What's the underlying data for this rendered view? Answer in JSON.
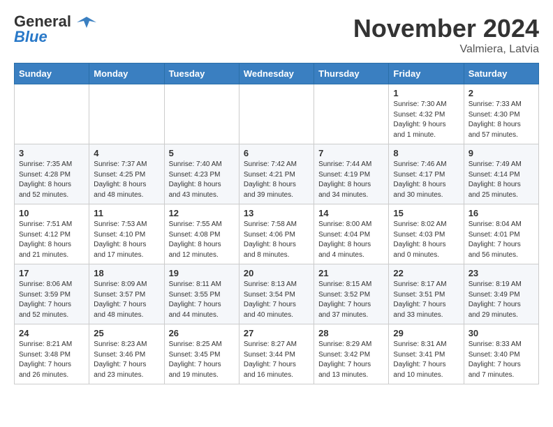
{
  "logo": {
    "general": "General",
    "blue": "Blue"
  },
  "title": "November 2024",
  "subtitle": "Valmiera, Latvia",
  "days_of_week": [
    "Sunday",
    "Monday",
    "Tuesday",
    "Wednesday",
    "Thursday",
    "Friday",
    "Saturday"
  ],
  "weeks": [
    [
      {
        "day": "",
        "info": ""
      },
      {
        "day": "",
        "info": ""
      },
      {
        "day": "",
        "info": ""
      },
      {
        "day": "",
        "info": ""
      },
      {
        "day": "",
        "info": ""
      },
      {
        "day": "1",
        "info": "Sunrise: 7:30 AM\nSunset: 4:32 PM\nDaylight: 9 hours\nand 1 minute."
      },
      {
        "day": "2",
        "info": "Sunrise: 7:33 AM\nSunset: 4:30 PM\nDaylight: 8 hours\nand 57 minutes."
      }
    ],
    [
      {
        "day": "3",
        "info": "Sunrise: 7:35 AM\nSunset: 4:28 PM\nDaylight: 8 hours\nand 52 minutes."
      },
      {
        "day": "4",
        "info": "Sunrise: 7:37 AM\nSunset: 4:25 PM\nDaylight: 8 hours\nand 48 minutes."
      },
      {
        "day": "5",
        "info": "Sunrise: 7:40 AM\nSunset: 4:23 PM\nDaylight: 8 hours\nand 43 minutes."
      },
      {
        "day": "6",
        "info": "Sunrise: 7:42 AM\nSunset: 4:21 PM\nDaylight: 8 hours\nand 39 minutes."
      },
      {
        "day": "7",
        "info": "Sunrise: 7:44 AM\nSunset: 4:19 PM\nDaylight: 8 hours\nand 34 minutes."
      },
      {
        "day": "8",
        "info": "Sunrise: 7:46 AM\nSunset: 4:17 PM\nDaylight: 8 hours\nand 30 minutes."
      },
      {
        "day": "9",
        "info": "Sunrise: 7:49 AM\nSunset: 4:14 PM\nDaylight: 8 hours\nand 25 minutes."
      }
    ],
    [
      {
        "day": "10",
        "info": "Sunrise: 7:51 AM\nSunset: 4:12 PM\nDaylight: 8 hours\nand 21 minutes."
      },
      {
        "day": "11",
        "info": "Sunrise: 7:53 AM\nSunset: 4:10 PM\nDaylight: 8 hours\nand 17 minutes."
      },
      {
        "day": "12",
        "info": "Sunrise: 7:55 AM\nSunset: 4:08 PM\nDaylight: 8 hours\nand 12 minutes."
      },
      {
        "day": "13",
        "info": "Sunrise: 7:58 AM\nSunset: 4:06 PM\nDaylight: 8 hours\nand 8 minutes."
      },
      {
        "day": "14",
        "info": "Sunrise: 8:00 AM\nSunset: 4:04 PM\nDaylight: 8 hours\nand 4 minutes."
      },
      {
        "day": "15",
        "info": "Sunrise: 8:02 AM\nSunset: 4:03 PM\nDaylight: 8 hours\nand 0 minutes."
      },
      {
        "day": "16",
        "info": "Sunrise: 8:04 AM\nSunset: 4:01 PM\nDaylight: 7 hours\nand 56 minutes."
      }
    ],
    [
      {
        "day": "17",
        "info": "Sunrise: 8:06 AM\nSunset: 3:59 PM\nDaylight: 7 hours\nand 52 minutes."
      },
      {
        "day": "18",
        "info": "Sunrise: 8:09 AM\nSunset: 3:57 PM\nDaylight: 7 hours\nand 48 minutes."
      },
      {
        "day": "19",
        "info": "Sunrise: 8:11 AM\nSunset: 3:55 PM\nDaylight: 7 hours\nand 44 minutes."
      },
      {
        "day": "20",
        "info": "Sunrise: 8:13 AM\nSunset: 3:54 PM\nDaylight: 7 hours\nand 40 minutes."
      },
      {
        "day": "21",
        "info": "Sunrise: 8:15 AM\nSunset: 3:52 PM\nDaylight: 7 hours\nand 37 minutes."
      },
      {
        "day": "22",
        "info": "Sunrise: 8:17 AM\nSunset: 3:51 PM\nDaylight: 7 hours\nand 33 minutes."
      },
      {
        "day": "23",
        "info": "Sunrise: 8:19 AM\nSunset: 3:49 PM\nDaylight: 7 hours\nand 29 minutes."
      }
    ],
    [
      {
        "day": "24",
        "info": "Sunrise: 8:21 AM\nSunset: 3:48 PM\nDaylight: 7 hours\nand 26 minutes."
      },
      {
        "day": "25",
        "info": "Sunrise: 8:23 AM\nSunset: 3:46 PM\nDaylight: 7 hours\nand 23 minutes."
      },
      {
        "day": "26",
        "info": "Sunrise: 8:25 AM\nSunset: 3:45 PM\nDaylight: 7 hours\nand 19 minutes."
      },
      {
        "day": "27",
        "info": "Sunrise: 8:27 AM\nSunset: 3:44 PM\nDaylight: 7 hours\nand 16 minutes."
      },
      {
        "day": "28",
        "info": "Sunrise: 8:29 AM\nSunset: 3:42 PM\nDaylight: 7 hours\nand 13 minutes."
      },
      {
        "day": "29",
        "info": "Sunrise: 8:31 AM\nSunset: 3:41 PM\nDaylight: 7 hours\nand 10 minutes."
      },
      {
        "day": "30",
        "info": "Sunrise: 8:33 AM\nSunset: 3:40 PM\nDaylight: 7 hours\nand 7 minutes."
      }
    ]
  ]
}
